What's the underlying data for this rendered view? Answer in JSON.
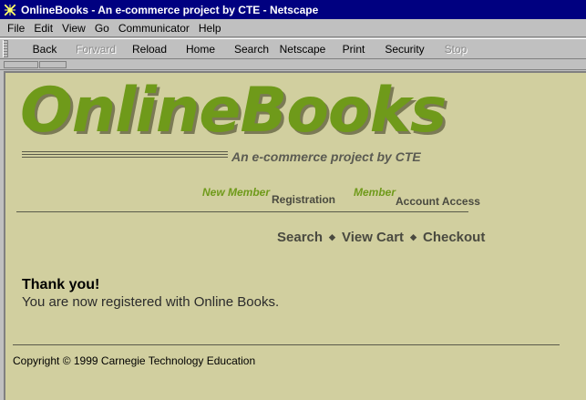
{
  "window": {
    "title": "OnlineBooks - An e-commerce project by CTE - Netscape"
  },
  "menu": {
    "items": [
      "File",
      "Edit",
      "View",
      "Go",
      "Communicator",
      "Help"
    ]
  },
  "toolbar": {
    "back": "Back",
    "forward": "Forward",
    "reload": "Reload",
    "home": "Home",
    "search": "Search",
    "netscape": "Netscape",
    "print": "Print",
    "security": "Security",
    "stop": "Stop"
  },
  "page": {
    "logo": "OnlineBooks",
    "tagline": "An e-commerce project by CTE",
    "new_member": "New Member",
    "registration": "Registration",
    "member": "Member",
    "account_access": "Account Access",
    "nav": {
      "search": "Search",
      "view_cart": "View Cart",
      "checkout": "Checkout",
      "separator": "◆"
    },
    "thank_you": "Thank you!",
    "message": "You are now registered with Online Books.",
    "copyright": "Copyright © 1999 Carnegie Technology Education"
  },
  "colors": {
    "title_bar": "#000080",
    "page_background": "#d1cf9f",
    "logo_green": "#6f9a1a"
  }
}
